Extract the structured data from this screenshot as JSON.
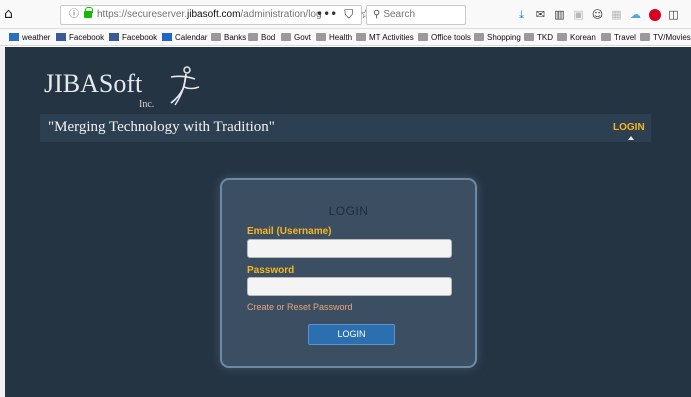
{
  "browser": {
    "url_prefix": "https://secureserver.",
    "url_domain": "jibasoft.com",
    "url_path": "/administration/log",
    "page_actions": [
      "•••"
    ],
    "search_placeholder": "Search",
    "toolbar_icons": [
      "download-icon",
      "mail-icon",
      "library-icon",
      "reader-icon",
      "account-icon",
      "extension-icon",
      "cloud-icon",
      "adblock-icon",
      "sidebar-icon"
    ]
  },
  "bookmarks": [
    {
      "label": "weather",
      "icon": "weather"
    },
    {
      "label": "Facebook",
      "icon": "fb"
    },
    {
      "label": "Facebook",
      "icon": "fb"
    },
    {
      "label": "Calendar",
      "icon": "cal"
    },
    {
      "label": "Banks",
      "icon": "folder"
    },
    {
      "label": "Bod",
      "icon": "folder"
    },
    {
      "label": "Govt",
      "icon": "folder"
    },
    {
      "label": "Health",
      "icon": "folder"
    },
    {
      "label": "MT Activities",
      "icon": "folder"
    },
    {
      "label": "Office tools",
      "icon": "folder"
    },
    {
      "label": "Shopping",
      "icon": "folder"
    },
    {
      "label": "TKD",
      "icon": "folder"
    },
    {
      "label": "Korean",
      "icon": "folder"
    },
    {
      "label": "Travel",
      "icon": "folder"
    },
    {
      "label": "TV/Movies",
      "icon": "folder"
    }
  ],
  "site": {
    "logo_text": "JIBASoft",
    "logo_sub": "Inc.",
    "tagline": "\"Merging Technology with Tradition\"",
    "nav_login": "LOGIN"
  },
  "login_form": {
    "title": "LOGIN",
    "email_label": "Email (Username)",
    "email_value": "",
    "password_label": "Password",
    "password_value": "",
    "reset_link": "Create or Reset Password",
    "submit_label": "LOGIN"
  },
  "colors": {
    "accent": "#f7b521",
    "button": "#2b6fb0",
    "link": "#e6a67c",
    "background": "#243443"
  }
}
